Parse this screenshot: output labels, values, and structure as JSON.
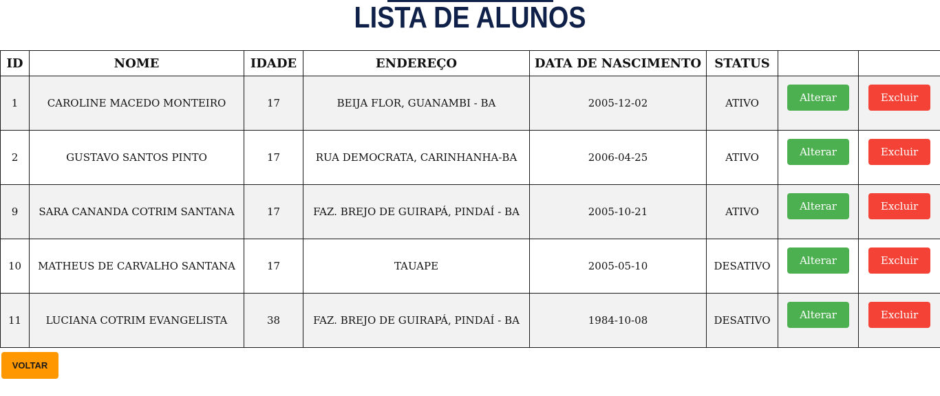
{
  "page": {
    "title": "LISTA DE ALUNOS",
    "back_label": "VOLTAR"
  },
  "table": {
    "headers": [
      "ID",
      "NOME",
      "IDADE",
      "ENDEREÇO",
      "DATA DE NASCIMENTO",
      "STATUS",
      "",
      ""
    ],
    "edit_label": "Alterar",
    "delete_label": "Excluir",
    "rows": [
      {
        "id": "1",
        "nome": "CAROLINE MACEDO MONTEIRO",
        "idade": "17",
        "endereco": "BEIJA FLOR, GUANAMBI - BA",
        "nascimento": "2005-12-02",
        "status": "ATIVO"
      },
      {
        "id": "2",
        "nome": "GUSTAVO SANTOS PINTO",
        "idade": "17",
        "endereco": "RUA DEMOCRATA, CARINHANHA-BA",
        "nascimento": "2006-04-25",
        "status": "ATIVO"
      },
      {
        "id": "9",
        "nome": "SARA CANANDA COTRIM SANTANA",
        "idade": "17",
        "endereco": "FAZ. BREJO DE GUIRAPÁ, PINDAÍ - BA",
        "nascimento": "2005-10-21",
        "status": "ATIVO"
      },
      {
        "id": "10",
        "nome": "MATHEUS DE CARVALHO SANTANA",
        "idade": "17",
        "endereco": "TAUAPE",
        "nascimento": "2005-05-10",
        "status": "DESATIVO"
      },
      {
        "id": "11",
        "nome": "LUCIANA COTRIM EVANGELISTA",
        "idade": "38",
        "endereco": "FAZ. BREJO DE GUIRAPÁ, PINDAÍ - BA",
        "nascimento": "1984-10-08",
        "status": "DESATIVO"
      }
    ]
  },
  "colors": {
    "title": "#0f2148",
    "edit_button": "#4caf50",
    "delete_button": "#f44336",
    "back_button": "#ff9800",
    "row_stripe": "#f2f2f2"
  }
}
